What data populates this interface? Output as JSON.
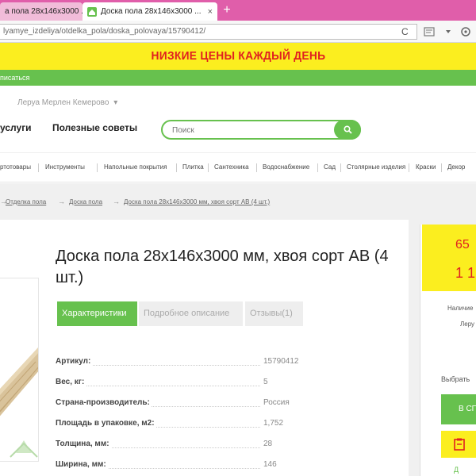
{
  "browser": {
    "tabs": [
      {
        "label": "а пола 28x146x3000 ...",
        "active": false
      },
      {
        "label": "Доска пола 28x146x3000 ...",
        "active": true
      }
    ],
    "new_tab": "+",
    "close_glyph": "×",
    "url": "lyamye_izdeliya/otdelka_pola/doska_polovaya/15790412/",
    "reload": "C",
    "menu": "≡"
  },
  "promo": {
    "text": "НИЗКИЕ ЦЕНЫ КАЖДЫЙ ДЕНЬ",
    "bg": "#fbee1f",
    "color": "#e02020"
  },
  "top_strip": {
    "text": "писаться"
  },
  "header": {
    "city": "Леруа Мерлен Кемерово",
    "city_caret": "▾",
    "nav": [
      "услуги",
      "Полезные советы"
    ],
    "search_placeholder": "Поиск"
  },
  "categories": [
    "ртотовары",
    "Инструменты",
    "Напольные покрытия",
    "Плитка",
    "Сантехника",
    "Водоснабжение",
    "Сад",
    "Столярные изделия",
    "Краски",
    "Декор"
  ],
  "breadcrumbs": [
    "Отделка пола",
    "Доска пола",
    "Доска пола 28x146x3000 мм, хвоя сорт АВ (4 шт.)"
  ],
  "breadcrumb_arrow": "→",
  "product": {
    "title": "Доска пола 28x146x3000 мм, хвоя сорт АВ (4 шт.)",
    "tabs": [
      "Характеристики",
      "Подробное описание",
      "Отзывы(1)"
    ],
    "specs": [
      {
        "label": "Артикул:",
        "value": "15790412"
      },
      {
        "label": "Вес, кг:",
        "value": "5"
      },
      {
        "label": "Страна-производитель:",
        "value": "Россия"
      },
      {
        "label": "Площадь в упаковке, м2:",
        "value": "1,752"
      },
      {
        "label": "Толщина, мм:",
        "value": "28"
      },
      {
        "label": "Ширина, мм:",
        "value": "146"
      }
    ]
  },
  "sidebar": {
    "price_top": "65",
    "price_bottom": "1 1",
    "availability": "Наличие",
    "store": "Леру",
    "choose": "Выбрать",
    "buy": "В СП",
    "link": "Д"
  },
  "colors": {
    "accent_green": "#67c14e",
    "tab_pink": "#e05eaa",
    "price_red": "#e02020"
  }
}
